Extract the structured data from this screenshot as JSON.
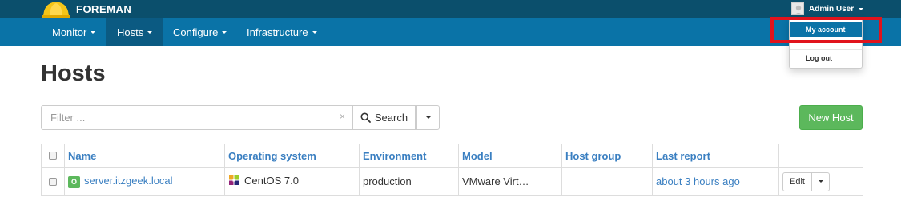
{
  "brand": {
    "name": "FOREMAN",
    "logo_icon": "hardhat-logo-icon",
    "accent": "#f5c518"
  },
  "colors": {
    "topbar": "#0b4f6c",
    "navbar": "#0a73a7",
    "nav_active": "#0b5a82",
    "link": "#3a7fc1",
    "primary_success": "#5cb85c",
    "highlight": "#e1131c"
  },
  "user_menu": {
    "name": "Admin User",
    "avatar_icon": "user-avatar-icon",
    "items": [
      {
        "label": "My account",
        "active": true
      },
      {
        "label": "Log out",
        "active": false
      }
    ]
  },
  "nav": {
    "items": [
      {
        "label": "Monitor",
        "active": false
      },
      {
        "label": "Hosts",
        "active": true
      },
      {
        "label": "Configure",
        "active": false
      },
      {
        "label": "Infrastructure",
        "active": false
      }
    ]
  },
  "page": {
    "title": "Hosts"
  },
  "toolbar": {
    "filter_placeholder": "Filter ...",
    "filter_value": "",
    "clear_glyph": "×",
    "search_label": "Search",
    "search_icon": "search-icon",
    "new_host_label": "New Host"
  },
  "table": {
    "columns": [
      "Name",
      "Operating system",
      "Environment",
      "Model",
      "Host group",
      "Last report"
    ],
    "rows": [
      {
        "status_badge": "O",
        "name": "server.itzgeek.local",
        "os": "CentOS 7.0",
        "os_icon": "centos-icon",
        "environment": "production",
        "model": "VMware Virt…",
        "host_group": "",
        "last_report": "about 3 hours ago",
        "action_label": "Edit"
      }
    ]
  }
}
